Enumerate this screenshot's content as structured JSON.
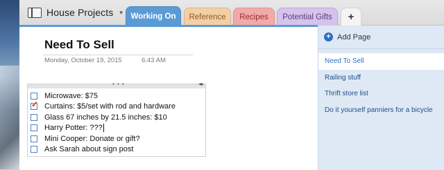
{
  "notebook": {
    "name": "House Projects",
    "caret": "▾"
  },
  "tabs": [
    {
      "label": "Working On",
      "active": true,
      "color": "#5b9bd5"
    },
    {
      "label": "Reference",
      "color": "#f4cfa6"
    },
    {
      "label": "Recipes",
      "color": "#f4a9a9"
    },
    {
      "label": "Potential Gifts",
      "color": "#d6c3ec"
    }
  ],
  "add_tab": "+",
  "page": {
    "title": "Need To Sell",
    "date": "Monday, October 19, 2015",
    "time": "6:43 AM"
  },
  "note": {
    "handle_dots": "• • •",
    "resize_glyph": "◂▸",
    "items": [
      {
        "text": "Microwave: $75",
        "checked": false
      },
      {
        "text": "Curtains: $5/set with rod and hardware",
        "checked": true
      },
      {
        "text": "Glass 67 inches by 21.5 inches: $10",
        "checked": false
      },
      {
        "text": "Harry Potter: ???",
        "checked": false
      },
      {
        "text": "Mini Cooper: Donate or gift?",
        "checked": false
      },
      {
        "text": "Ask Sarah about sign post",
        "checked": false
      }
    ],
    "checkmark": "✓"
  },
  "pages_panel": {
    "add_page_label": "Add Page",
    "add_page_icon": "+",
    "pages": [
      {
        "label": "Need To Sell",
        "selected": true
      },
      {
        "label": "Railing stuff",
        "selected": false
      },
      {
        "label": "Thrift store list",
        "selected": false
      },
      {
        "label": "Do it yourself panniers for a bicycle",
        "selected": false
      }
    ]
  },
  "colors": {
    "accent": "#5b9bd5",
    "panel_bg": "#dfe9f5",
    "check_red": "#d12f2f"
  }
}
